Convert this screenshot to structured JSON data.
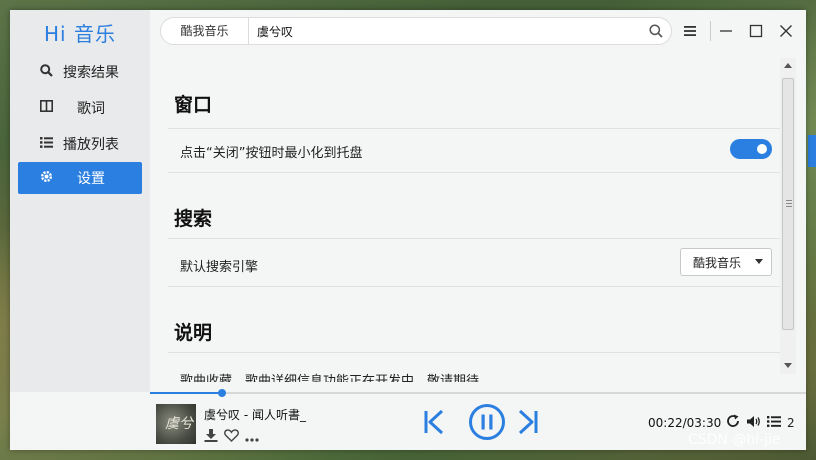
{
  "app": {
    "title": "Hi 音乐"
  },
  "sidebar": {
    "items": [
      {
        "label": "搜索结果",
        "icon": "search-icon"
      },
      {
        "label": "歌词",
        "icon": "lyrics-icon"
      },
      {
        "label": "播放列表",
        "icon": "list-icon"
      },
      {
        "label": "设置",
        "icon": "gear-icon",
        "active": true
      }
    ]
  },
  "search": {
    "engine": "酷我音乐",
    "query": "虞兮叹"
  },
  "settings": {
    "window_title": "窗口",
    "minimize_label": "点击“关闭”按钮时最小化到托盘",
    "minimize_enabled": true,
    "search_title": "搜索",
    "engine_label": "默认搜索引擎",
    "engine_value": "酷我音乐",
    "about_title": "说明",
    "about_text": "歌曲收藏、歌曲详细信息功能正在开发中，敬请期待"
  },
  "player": {
    "cover_text": "虞兮",
    "track": "虞兮叹 - 闻人听書_",
    "time": "00:22/03:30",
    "progress_percent": 11,
    "queue_count": "2"
  },
  "watermark": "CSDN @hi-jie",
  "colors": {
    "accent": "#2b7fe0",
    "sidebar_bg": "#e9eaeb",
    "content_bg": "#f4f5f5"
  }
}
